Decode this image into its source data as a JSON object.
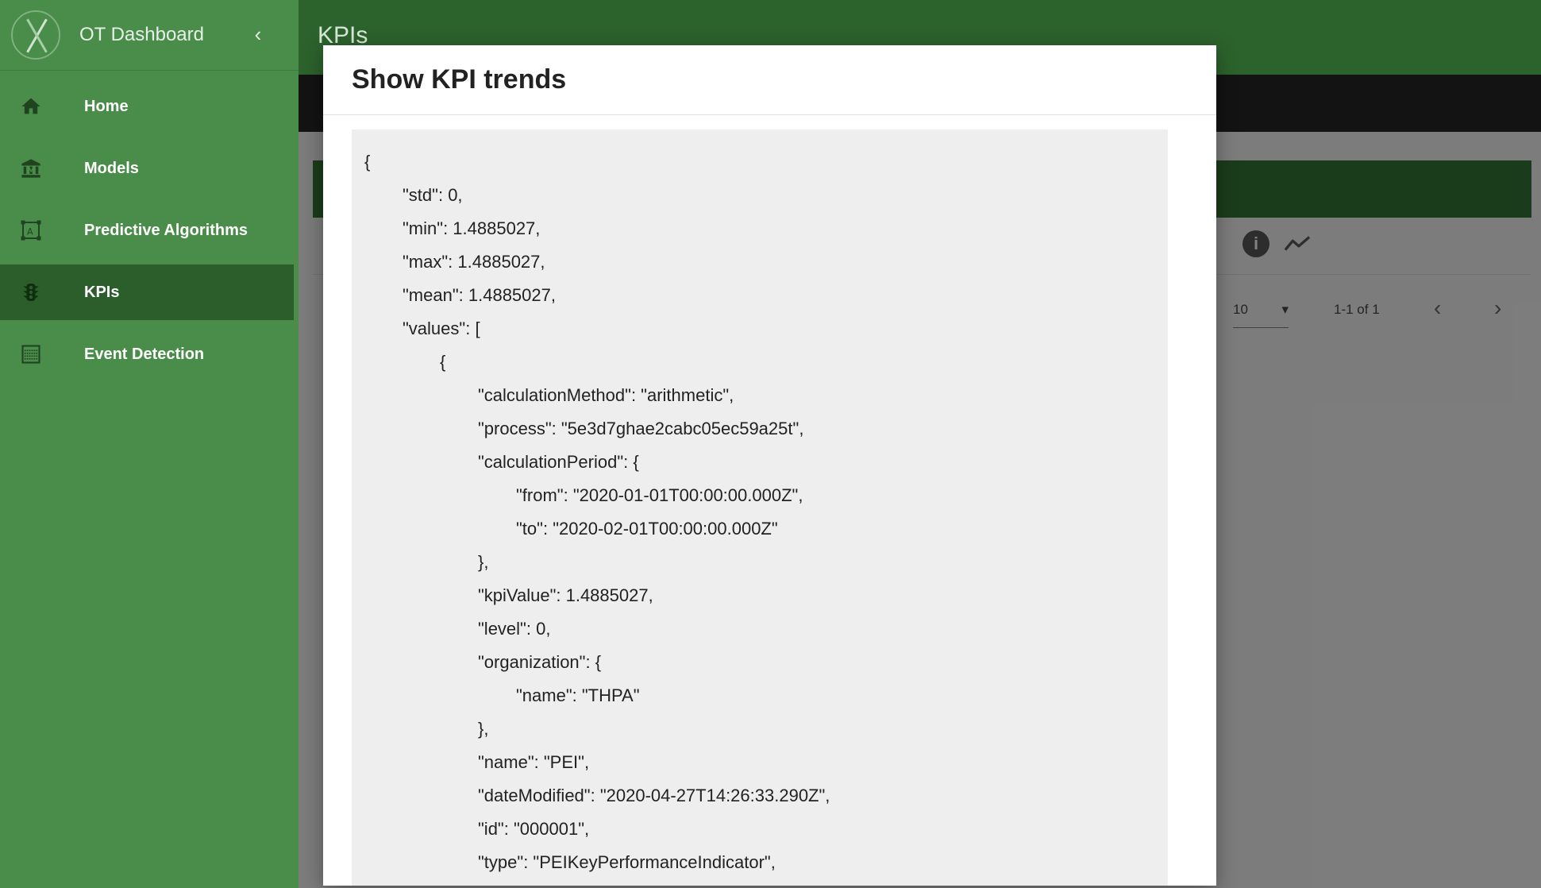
{
  "app": {
    "title": "OT Dashboard",
    "collapse_icon": "chevron-left-icon"
  },
  "sidebar": {
    "items": [
      {
        "label": "Home",
        "icon": "home-icon",
        "active": false
      },
      {
        "label": "Models",
        "icon": "museum-icon",
        "active": false
      },
      {
        "label": "Predictive Algorithms",
        "icon": "algorithm-icon",
        "active": false
      },
      {
        "label": "KPIs",
        "icon": "traffic-light-icon",
        "active": true
      },
      {
        "label": "Event Detection",
        "icon": "grid-icon",
        "active": false
      }
    ]
  },
  "page": {
    "title": "KPIs"
  },
  "toolbar": {
    "info_icon": "info-icon",
    "trend_icon": "trend-icon"
  },
  "pagination": {
    "rows_per_page": "10",
    "range": "1-1 of 1"
  },
  "modal": {
    "title": "Show KPI trends",
    "json_lines": [
      {
        "text": "{",
        "indent": 0
      },
      {
        "text": "\"std\": 0,",
        "indent": 1
      },
      {
        "text": "\"min\": 1.4885027,",
        "indent": 1
      },
      {
        "text": "\"max\": 1.4885027,",
        "indent": 1
      },
      {
        "text": "\"mean\": 1.4885027,",
        "indent": 1
      },
      {
        "text": "\"values\": [",
        "indent": 1
      },
      {
        "text": "{",
        "indent": 2
      },
      {
        "text": "\"calculationMethod\": \"arithmetic\",",
        "indent": 3
      },
      {
        "text": "\"process\": \"5e3d7ghae2cabc05ec59a25t\",",
        "indent": 3
      },
      {
        "text": "\"calculationPeriod\": {",
        "indent": 3
      },
      {
        "text": "\"from\": \"2020-01-01T00:00:00.000Z\",",
        "indent": 4
      },
      {
        "text": "\"to\": \"2020-02-01T00:00:00.000Z\"",
        "indent": 4
      },
      {
        "text": "},",
        "indent": 3
      },
      {
        "text": "\"kpiValue\": 1.4885027,",
        "indent": 3
      },
      {
        "text": "\"level\": 0,",
        "indent": 3
      },
      {
        "text": "\"organization\": {",
        "indent": 3
      },
      {
        "text": "\"name\": \"THPA\"",
        "indent": 4
      },
      {
        "text": "},",
        "indent": 3
      },
      {
        "text": "\"name\": \"PEI\",",
        "indent": 3
      },
      {
        "text": "\"dateModified\": \"2020-04-27T14:26:33.290Z\",",
        "indent": 3
      },
      {
        "text": "\"id\": \"000001\",",
        "indent": 3
      },
      {
        "text": "\"type\": \"PEIKeyPerformanceIndicator\",",
        "indent": 3
      }
    ]
  }
}
